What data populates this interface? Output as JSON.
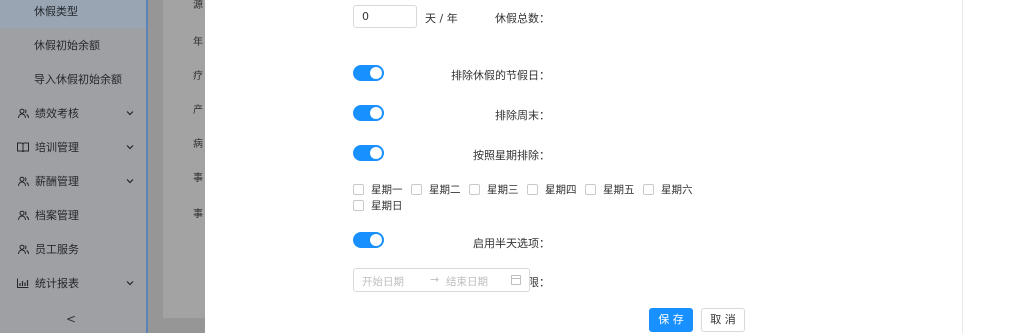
{
  "sidebar": {
    "items": [
      {
        "label": "休假类型",
        "icon": "",
        "selected": true
      },
      {
        "label": "休假初始余额",
        "icon": ""
      },
      {
        "label": "导入休假初始余额",
        "icon": ""
      },
      {
        "label": "绩效考核",
        "icon": "people-icon",
        "chevron": "⌄"
      },
      {
        "label": "培训管理",
        "icon": "book-icon",
        "chevron": "⌄"
      },
      {
        "label": "薪酬管理",
        "icon": "people-icon",
        "chevron": "⌄"
      },
      {
        "label": "档案管理",
        "icon": "people-icon"
      },
      {
        "label": "员工服务",
        "icon": "people-icon"
      },
      {
        "label": "统计报表",
        "icon": "chart-icon",
        "chevron": "⌄"
      }
    ],
    "collapse_label": "<"
  },
  "background_list": {
    "rows": [
      "源",
      "年",
      "疗",
      "产",
      "病",
      "事",
      "事"
    ]
  },
  "form": {
    "total_label": "休假总数：",
    "total_value": "0",
    "total_unit": "天 / 年",
    "exclude_holidays_label": "排除休假的节假日：",
    "exclude_weekends_label": "排除周末：",
    "exclude_weekday_label": "按照星期排除：",
    "weekday_colon": ":",
    "weekdays": [
      "星期一",
      "星期二",
      "星期三",
      "星期四",
      "星期五",
      "星期六",
      "星期日"
    ],
    "half_day_label": "启用半天选项：",
    "period_label": "期限：",
    "start_placeholder": "开始日期",
    "end_placeholder": "结束日期",
    "range_arrow": "→"
  },
  "actions": {
    "save_label": "保 存",
    "cancel_label": "取 消"
  },
  "colors": {
    "accent": "#1890ff"
  }
}
